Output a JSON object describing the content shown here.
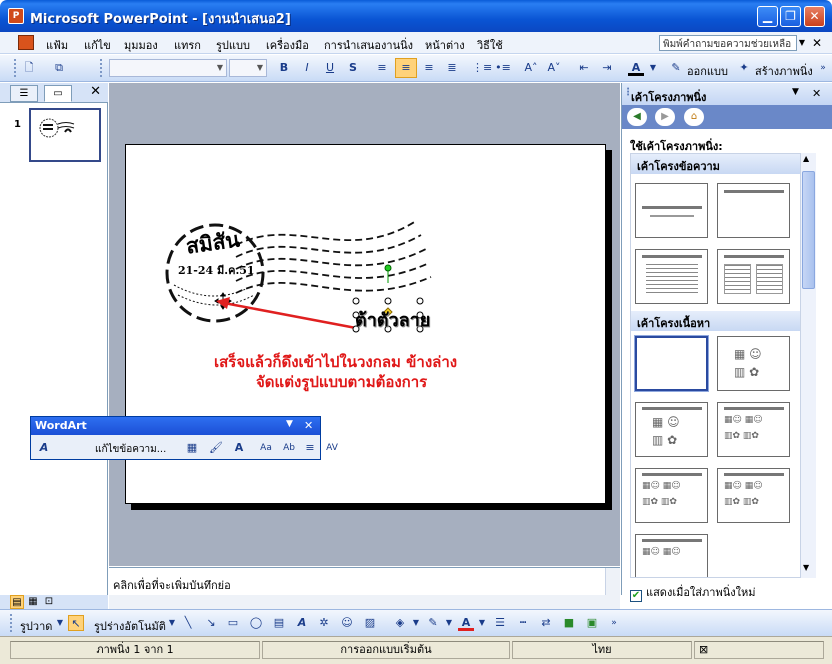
{
  "window": {
    "title": "Microsoft PowerPoint - [งานนำเสนอ2]",
    "app_icon_label": "P"
  },
  "menu": {
    "items": [
      "แฟ้ม",
      "แก้ไข",
      "มุมมอง",
      "แทรก",
      "รูปแบบ",
      "เครื่องมือ",
      "การนำเสนองานนิ่ง",
      "หน้าต่าง",
      "วิธีใช้"
    ],
    "help_placeholder": "พิมพ์คำถามขอความช่วยเหลือ"
  },
  "toolbar": {
    "font_bold": "B",
    "font_italic": "I",
    "font_underline": "U",
    "font_shadow": "S",
    "design_label": "ออกแบบ",
    "new_slide_label": "สร้างภาพนิ่ง"
  },
  "slides_pane": {
    "slide_number": "1"
  },
  "slide": {
    "stamp_title": "สมิสัน",
    "stamp_date": "21-24 มี.ค.51",
    "wordart_text": "ต้าตัวลาย",
    "caption_line1": "เสร็จแล้วก็ดึงเข้าไปในวงกลม ข้างล่าง",
    "caption_line2": "จัดแต่งรูปแบบตามต้องการ"
  },
  "wordart_toolbar": {
    "title": "WordArt",
    "edit_text_label": "แก้ไขข้อความ..."
  },
  "notes": {
    "placeholder": "คลิกเพื่อที่จะเพิ่มบันทึกย่อ"
  },
  "task_pane": {
    "title": "เค้าโครงภาพนิ่ง",
    "apply_label": "ใช้เค้าโครงภาพนิ่ง:",
    "section_text": "เค้าโครงข้อความ",
    "section_content": "เค้าโครงเนื้อหา",
    "footer_label": "แสดงเมื่อใส่ภาพนิ่งใหม่"
  },
  "draw_toolbar": {
    "draw_label": "รูปวาด",
    "autoshapes_label": "รูปร่างอัตโนมัติ"
  },
  "status": {
    "slide_info": "ภาพนิ่ง 1 จาก 1",
    "design": "การออกแบบเริ่มต้น",
    "language": "ไทย"
  },
  "colors": {
    "title_bar": "#0a55d4",
    "caption": "#e01818",
    "arrow": "#e02020"
  }
}
